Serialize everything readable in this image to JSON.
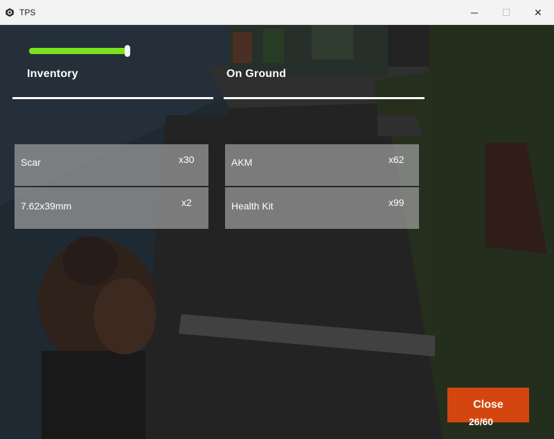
{
  "window": {
    "title": "TPS",
    "minimize_glyph": "─",
    "maximize_glyph": "☐",
    "close_glyph": "✕"
  },
  "hud": {
    "health_fraction": 0.97,
    "health_color": "#7ce11d"
  },
  "inventory": {
    "title": "Inventory",
    "items": [
      {
        "name": "Scar",
        "quantity": "x30"
      },
      {
        "name": "7.62x39mm",
        "quantity": "x2"
      }
    ]
  },
  "on_ground": {
    "title": "On Ground",
    "items": [
      {
        "name": "AKM",
        "quantity": "x62"
      },
      {
        "name": "Health Kit",
        "quantity": "x99"
      }
    ]
  },
  "footer": {
    "close_label": "Close",
    "counter": "26/60",
    "close_color": "#d4460f"
  }
}
